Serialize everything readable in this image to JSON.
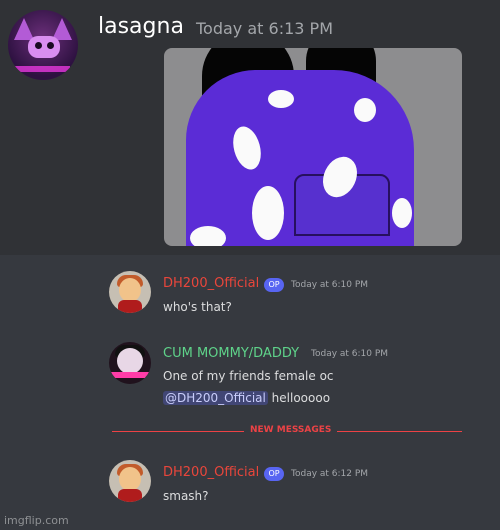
{
  "top_message": {
    "username": "lasagna",
    "timestamp": "Today at 6:13 PM"
  },
  "messages": [
    {
      "username": "DH200_Official",
      "badge": "OP",
      "timestamp": "Today at 6:10 PM",
      "text": "who's that?"
    },
    {
      "username": "CUM MOMMY/DADDY",
      "timestamp": "Today at 6:10 PM",
      "text": "One of my friends female oc",
      "mention": "@DH200_Official",
      "reply": "hellooooo"
    },
    {
      "username": "DH200_Official",
      "badge": "OP",
      "timestamp": "Today at 6:12 PM",
      "text": "smash?"
    }
  ],
  "divider": "NEW MESSAGES",
  "watermark": "imgflip.com",
  "colors": {
    "background": "#36393f",
    "username_red": "#e9463b",
    "username_green": "#5fd38a",
    "badge_blurple": "#5865f2",
    "new_messages_red": "#ed4245",
    "hoodie_purple": "#5b2cd6"
  }
}
